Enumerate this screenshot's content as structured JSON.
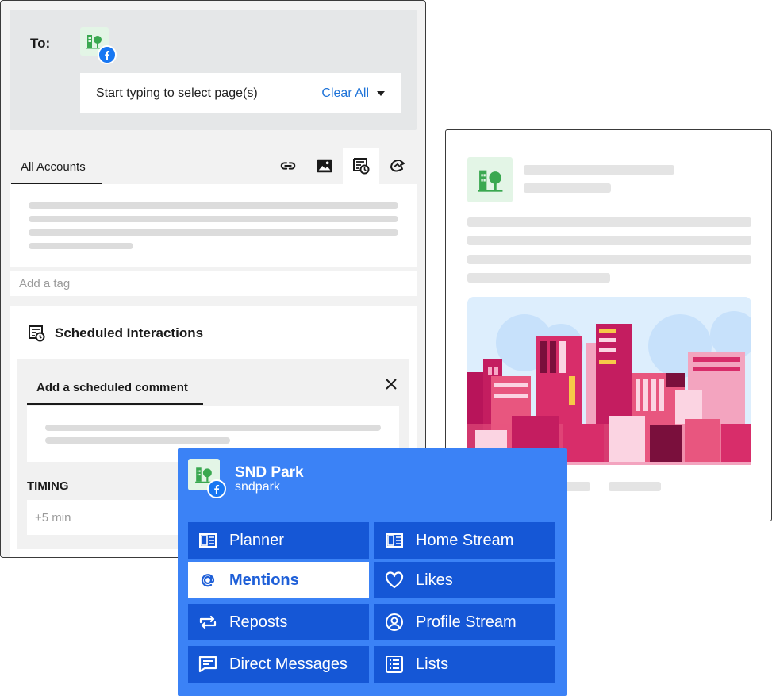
{
  "composer": {
    "to_label": "To:",
    "page_selector_placeholder": "Start typing to select page(s)",
    "clear_all_label": "Clear All",
    "accounts_tab_label": "All Accounts",
    "tag_placeholder": "Add a tag",
    "scheduled_section_title": "Scheduled Interactions",
    "comment_tab_label": "Add a scheduled comment",
    "timing_label": "TIMING",
    "timing_placeholder": "+5 min"
  },
  "streams_menu": {
    "page_name": "SND Park",
    "page_handle": "sndpark",
    "items": [
      {
        "label": "Planner",
        "icon": "planner-icon",
        "selected": false
      },
      {
        "label": "Home Stream",
        "icon": "stream-icon",
        "selected": false
      },
      {
        "label": "Mentions",
        "icon": "at-icon",
        "selected": true
      },
      {
        "label": "Likes",
        "icon": "heart-icon",
        "selected": false
      },
      {
        "label": "Reposts",
        "icon": "repost-icon",
        "selected": false
      },
      {
        "label": "Profile Stream",
        "icon": "profile-icon",
        "selected": false
      },
      {
        "label": "Direct Messages",
        "icon": "message-icon",
        "selected": false
      },
      {
        "label": "Lists",
        "icon": "list-icon",
        "selected": false
      }
    ]
  },
  "colors": {
    "menu_bg": "#3b82f6",
    "menu_item_bg": "#1557d6",
    "link_blue": "#1e73d8",
    "facebook_blue": "#1877f2",
    "brand_green": "#3aa850"
  }
}
